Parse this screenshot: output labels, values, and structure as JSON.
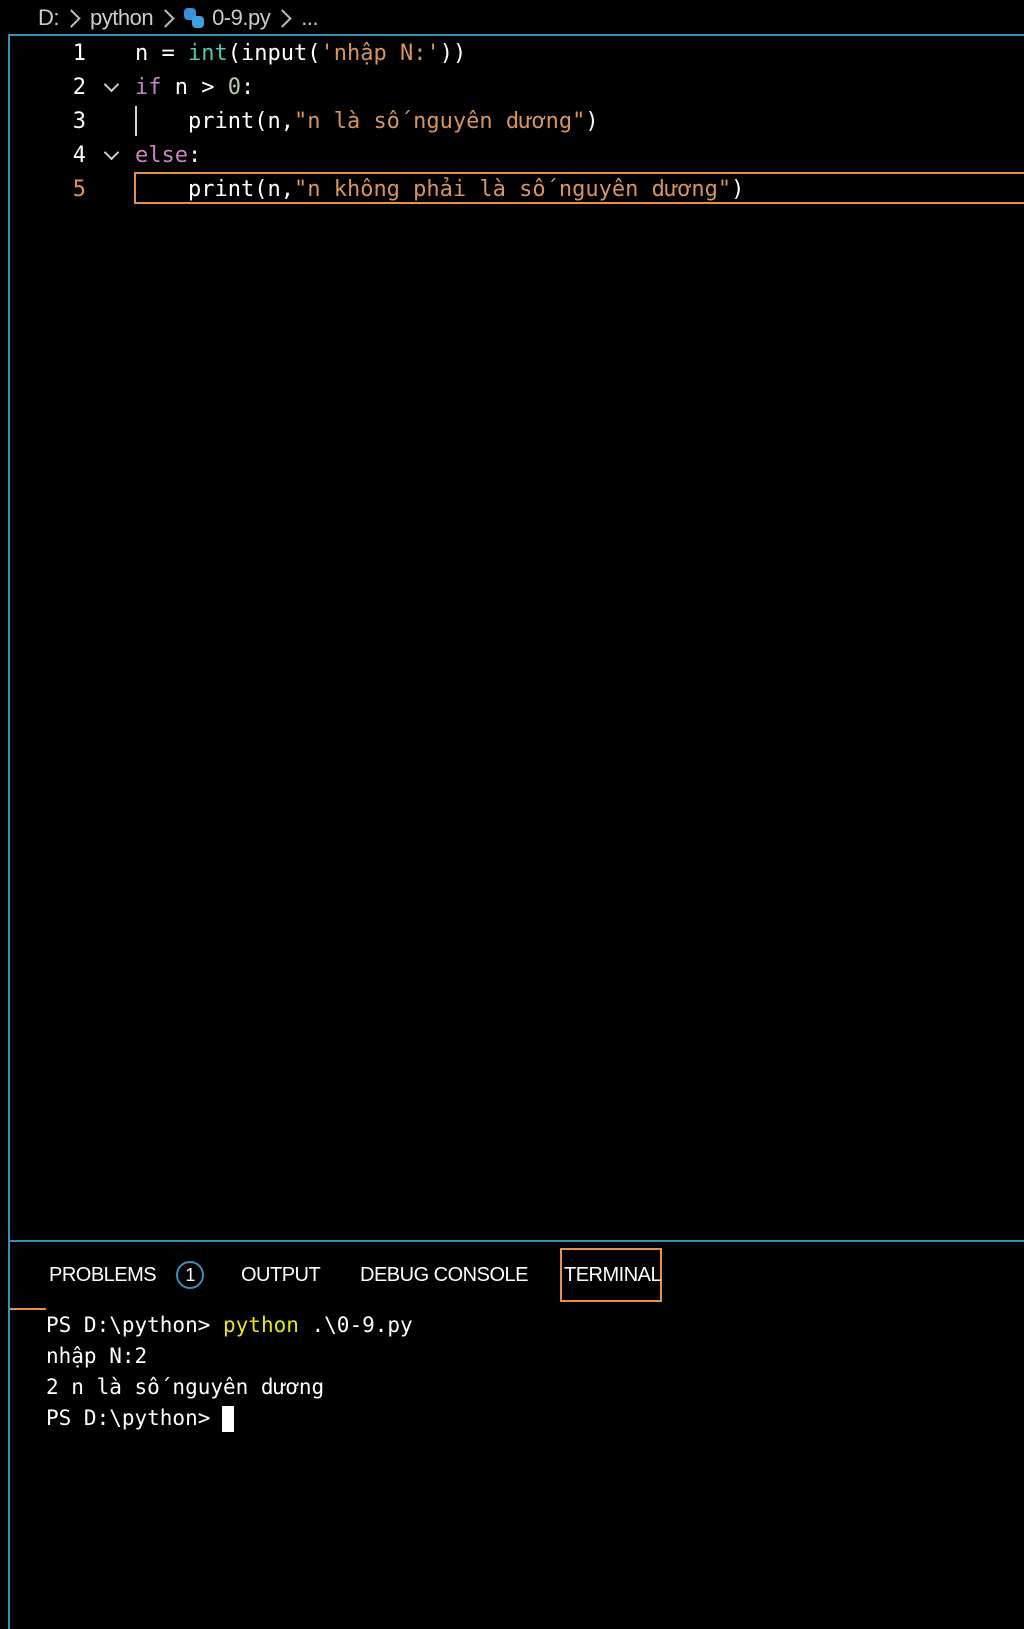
{
  "breadcrumb": {
    "drive": "D:",
    "folder": "python",
    "file": "0-9.py",
    "more": "..."
  },
  "editor": {
    "lines": [
      {
        "number": "1",
        "tokens": [
          {
            "text": "n ",
            "kind": "var"
          },
          {
            "text": "= ",
            "kind": "op"
          },
          {
            "text": "int",
            "kind": "fn-builtin"
          },
          {
            "text": "(",
            "kind": "punc"
          },
          {
            "text": "input",
            "kind": "fn"
          },
          {
            "text": "(",
            "kind": "punc"
          },
          {
            "text": "'nhập N:'",
            "kind": "str"
          },
          {
            "text": "))",
            "kind": "punc"
          }
        ]
      },
      {
        "number": "2",
        "tokens": [
          {
            "text": "if ",
            "kind": "kw"
          },
          {
            "text": "n ",
            "kind": "var"
          },
          {
            "text": "> ",
            "kind": "op"
          },
          {
            "text": "0",
            "kind": "num"
          },
          {
            "text": ":",
            "kind": "punc"
          }
        ]
      },
      {
        "number": "3",
        "tokens": [
          {
            "text": "    print",
            "kind": "fn"
          },
          {
            "text": "(n,",
            "kind": "punc"
          },
          {
            "text": "\"n là số nguyên dương\"",
            "kind": "str"
          },
          {
            "text": ")",
            "kind": "punc"
          }
        ]
      },
      {
        "number": "4",
        "tokens": [
          {
            "text": "else",
            "kind": "kw"
          },
          {
            "text": ":",
            "kind": "punc"
          }
        ]
      },
      {
        "number": "5",
        "tokens": [
          {
            "text": "    print",
            "kind": "fn"
          },
          {
            "text": "(n,",
            "kind": "punc"
          },
          {
            "text": "\"n không phải là số nguyên dương\"",
            "kind": "str"
          },
          {
            "text": ")",
            "kind": "punc"
          }
        ]
      }
    ]
  },
  "panel": {
    "tabs": {
      "problems": "PROBLEMS",
      "problems_count": "1",
      "output": "OUTPUT",
      "debug_console": "DEBUG CONSOLE",
      "terminal": "TERMINAL"
    }
  },
  "terminal": {
    "line1_prompt": "PS D:\\python> ",
    "line1_cmd": "python",
    "line1_args": " .\\0-9.py",
    "line2": "nhập N:2",
    "line3": "2 n là số nguyên dương",
    "line4_prompt": "PS D:\\python>"
  },
  "colors": {
    "accent_border": "#3b8fb5",
    "active_highlight": "#e8914a",
    "keyword": "#c586c0",
    "string": "#d7945f",
    "builtin": "#4ec9b0",
    "number": "#b5cea8",
    "terminal_command": "#e5e510"
  }
}
